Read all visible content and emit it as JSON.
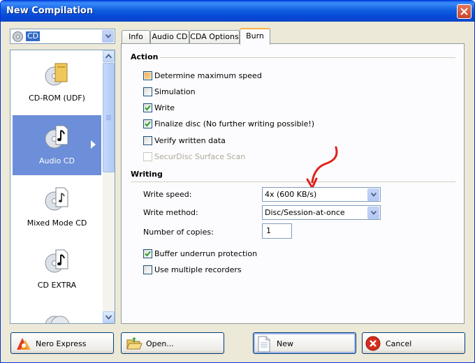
{
  "window": {
    "title": "New Compilation"
  },
  "media_selector": {
    "value": "CD",
    "icon": "cd-disc-icon"
  },
  "compilation_types": [
    {
      "label": "CD-ROM (UDF)",
      "icon": "cd-rom-udf-icon",
      "selected": false
    },
    {
      "label": "Audio CD",
      "icon": "audio-cd-icon",
      "selected": true
    },
    {
      "label": "Mixed Mode CD",
      "icon": "mixed-mode-cd-icon",
      "selected": false
    },
    {
      "label": "CD EXTRA",
      "icon": "cd-extra-icon",
      "selected": false
    }
  ],
  "tabs": [
    {
      "label": "Info",
      "active": false
    },
    {
      "label": "Audio CD",
      "active": false
    },
    {
      "label": "CDA Options",
      "active": false
    },
    {
      "label": "Burn",
      "active": true
    }
  ],
  "burn": {
    "action_title": "Action",
    "action_options": [
      {
        "label": "Determine maximum speed",
        "checked": false,
        "state": "highlighted"
      },
      {
        "label": "Simulation",
        "checked": false
      },
      {
        "label": "Write",
        "checked": true
      },
      {
        "label": "Finalize disc (No further writing possible!)",
        "checked": true
      },
      {
        "label": "Verify written data",
        "checked": false
      },
      {
        "label": "SecurDisc Surface Scan",
        "checked": false,
        "disabled": true
      }
    ],
    "writing_title": "Writing",
    "write_speed_label": "Write speed:",
    "write_speed_value": "4x (600 KB/s)",
    "write_method_label": "Write method:",
    "write_method_value": "Disc/Session-at-once",
    "copies_label": "Number of copies:",
    "copies_value": "1",
    "writing_options": [
      {
        "label": "Buffer underrun protection",
        "checked": true
      },
      {
        "label": "Use multiple recorders",
        "checked": false
      }
    ]
  },
  "buttons": {
    "nero_express": "Nero Express",
    "open": "Open...",
    "new": "New",
    "cancel": "Cancel"
  },
  "colors": {
    "titlebar": "#0a5ee6",
    "selection": "#6d8ed8",
    "annotation_arrow": "#e0201c"
  }
}
